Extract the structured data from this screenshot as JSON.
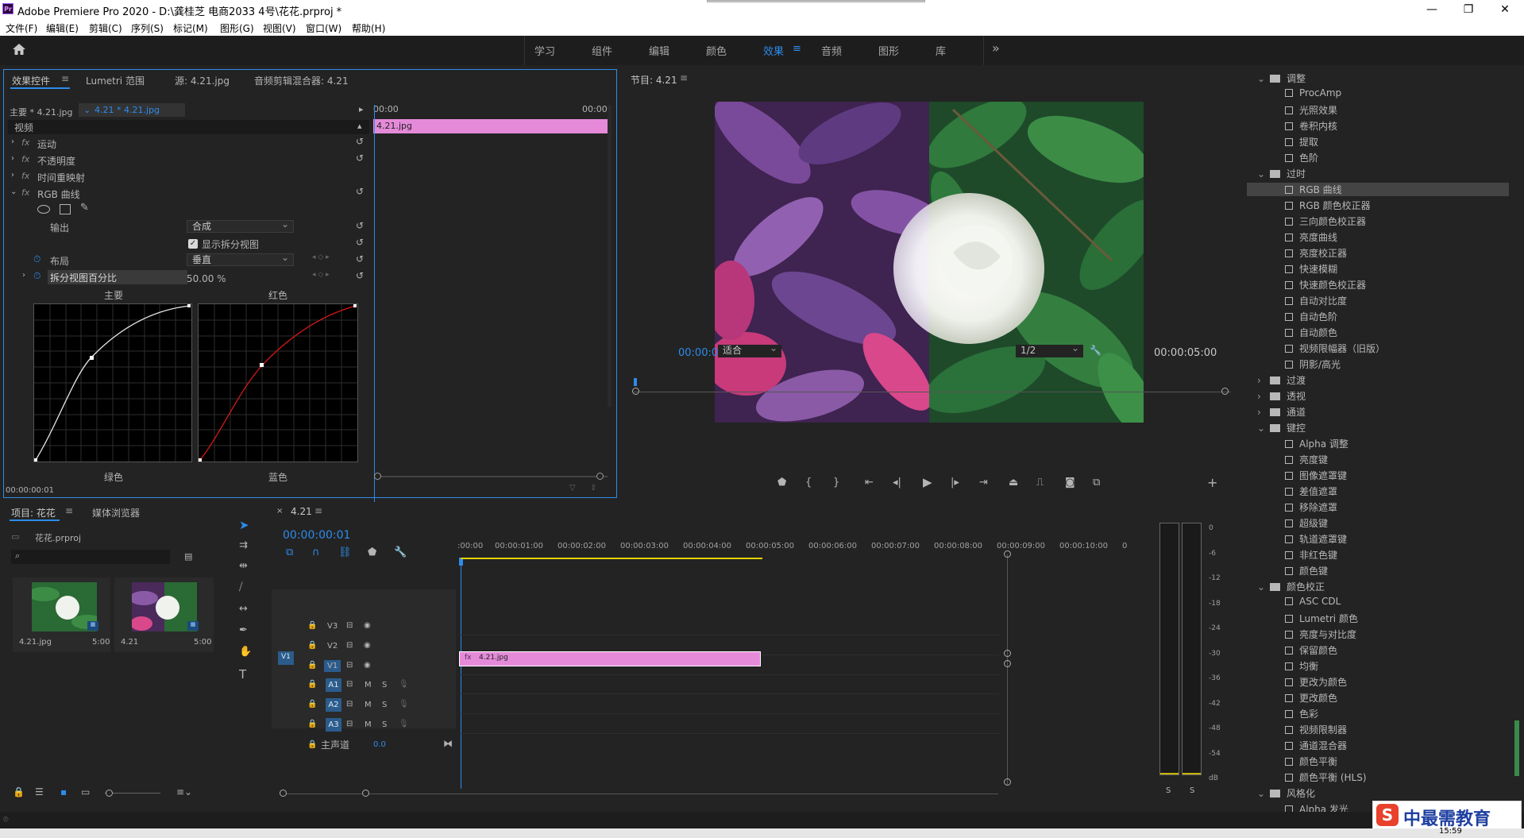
{
  "window": {
    "title": "Adobe Premiere Pro 2020 - D:\\龚桂芝 电商2033 4号\\花花.prproj *",
    "app_icon": "Pr",
    "minimize": "—",
    "maximize": "❐",
    "close": "✕"
  },
  "menu": [
    "文件(F)",
    "编辑(E)",
    "剪辑(C)",
    "序列(S)",
    "标记(M)",
    "图形(G)",
    "视图(V)",
    "窗口(W)",
    "帮助(H)"
  ],
  "workspaces": {
    "items": [
      "学习",
      "组件",
      "编辑",
      "颜色",
      "效果",
      "音频",
      "图形",
      "库"
    ],
    "active": "效果",
    "menu_icon": "≡",
    "more_icon": "»"
  },
  "effect_controls": {
    "tabs": [
      "效果控件",
      "Lumetri 范围",
      "源: 4.21.jpg",
      "音频剪辑混合器: 4.21"
    ],
    "active_tab": "效果控件",
    "master_label": "主要 * 4.21.jpg",
    "seq_clip": "4.21 * 4.21.jpg",
    "timecode_start": "00:00",
    "timecode_end": "00:00",
    "clip_name": "4.21.jpg",
    "video_header": "视频",
    "fx_label": "fx",
    "effects": [
      "运动",
      "不透明度",
      "时间重映射",
      "RGB 曲线"
    ],
    "output_label": "输出",
    "output_value": "合成",
    "show_split_label": "显示拆分视图",
    "layout_label": "布局",
    "layout_value": "垂直",
    "split_percent_label": "拆分视图百分比",
    "split_percent_value": "50.00 %",
    "curve_labels": {
      "master": "主要",
      "red": "红色",
      "green": "绿色",
      "blue": "蓝色"
    },
    "footer_tc": "00:00:00:01"
  },
  "program": {
    "title": "节目: 4.21",
    "timecode": "00:00:00:01",
    "fit": "适合",
    "resolution": "1/2",
    "duration": "00:00:05:00"
  },
  "effects_panel": {
    "tree": [
      {
        "type": "folder",
        "label": "调整",
        "open": true
      },
      {
        "type": "item",
        "label": "ProcAmp"
      },
      {
        "type": "item",
        "label": "光照效果"
      },
      {
        "type": "item",
        "label": "卷积内核"
      },
      {
        "type": "item",
        "label": "提取"
      },
      {
        "type": "item",
        "label": "色阶"
      },
      {
        "type": "folder",
        "label": "过时",
        "open": true
      },
      {
        "type": "item",
        "label": "RGB 曲线",
        "selected": true
      },
      {
        "type": "item",
        "label": "RGB 颜色校正器"
      },
      {
        "type": "item",
        "label": "三向颜色校正器"
      },
      {
        "type": "item",
        "label": "亮度曲线"
      },
      {
        "type": "item",
        "label": "亮度校正器"
      },
      {
        "type": "item",
        "label": "快速模糊"
      },
      {
        "type": "item",
        "label": "快速颜色校正器"
      },
      {
        "type": "item",
        "label": "自动对比度"
      },
      {
        "type": "item",
        "label": "自动色阶"
      },
      {
        "type": "item",
        "label": "自动颜色"
      },
      {
        "type": "item",
        "label": "视频限幅器（旧版）"
      },
      {
        "type": "item",
        "label": "阴影/高光"
      },
      {
        "type": "folder",
        "label": "过渡",
        "open": false
      },
      {
        "type": "folder",
        "label": "透视",
        "open": false
      },
      {
        "type": "folder",
        "label": "通道",
        "open": false
      },
      {
        "type": "folder",
        "label": "键控",
        "open": true
      },
      {
        "type": "item",
        "label": "Alpha 调整"
      },
      {
        "type": "item",
        "label": "亮度键"
      },
      {
        "type": "item",
        "label": "图像遮罩键"
      },
      {
        "type": "item",
        "label": "差值遮罩"
      },
      {
        "type": "item",
        "label": "移除遮罩"
      },
      {
        "type": "item",
        "label": "超级键"
      },
      {
        "type": "item",
        "label": "轨道遮罩键"
      },
      {
        "type": "item",
        "label": "非红色键"
      },
      {
        "type": "item",
        "label": "颜色键"
      },
      {
        "type": "folder",
        "label": "颜色校正",
        "open": true
      },
      {
        "type": "item",
        "label": "ASC CDL"
      },
      {
        "type": "item",
        "label": "Lumetri 颜色"
      },
      {
        "type": "item",
        "label": "亮度与对比度"
      },
      {
        "type": "item",
        "label": "保留颜色"
      },
      {
        "type": "item",
        "label": "均衡"
      },
      {
        "type": "item",
        "label": "更改为颜色"
      },
      {
        "type": "item",
        "label": "更改颜色"
      },
      {
        "type": "item",
        "label": "色彩"
      },
      {
        "type": "item",
        "label": "视频限制器"
      },
      {
        "type": "item",
        "label": "通道混合器"
      },
      {
        "type": "item",
        "label": "颜色平衡"
      },
      {
        "type": "item",
        "label": "颜色平衡 (HLS)"
      },
      {
        "type": "folder",
        "label": "风格化",
        "open": true
      },
      {
        "type": "item",
        "label": "Alpha 发光"
      }
    ]
  },
  "project": {
    "tabs": [
      "项目: 花花",
      "媒体浏览器"
    ],
    "file": "花花.prproj",
    "items": [
      {
        "name": "4.21.jpg",
        "duration": "5:00"
      },
      {
        "name": "4.21",
        "duration": "5:00"
      }
    ]
  },
  "timeline": {
    "seq_name": "4.21",
    "timecode": "00:00:00:01",
    "ruler": [
      ":00:00",
      "00:00:01:00",
      "00:00:02:00",
      "00:00:03:00",
      "00:00:04:00",
      "00:00:05:00",
      "00:00:06:00",
      "00:00:07:00",
      "00:00:08:00",
      "00:00:09:00",
      "00:00:10:00",
      "0"
    ],
    "video_tracks": [
      "V3",
      "V2",
      "V1"
    ],
    "audio_tracks": [
      "A1",
      "A2",
      "A3"
    ],
    "source_patch": "V1",
    "master_label": "主声道",
    "master_value": "0.0",
    "clip_name": "4.21.jpg",
    "m": "M",
    "s": "S"
  },
  "meter": {
    "scale": [
      "0",
      "-6",
      "-12",
      "-18",
      "-24",
      "-30",
      "-36",
      "-42",
      "-48",
      "-54",
      "dB"
    ],
    "s1": "S",
    "s2": "S"
  },
  "watermark": {
    "logo": "S",
    "text": "中最需教育"
  },
  "clock": "15:59",
  "colors": {
    "accent": "#2d8ceb",
    "clip": "#e58ad9",
    "panel": "#232323"
  }
}
